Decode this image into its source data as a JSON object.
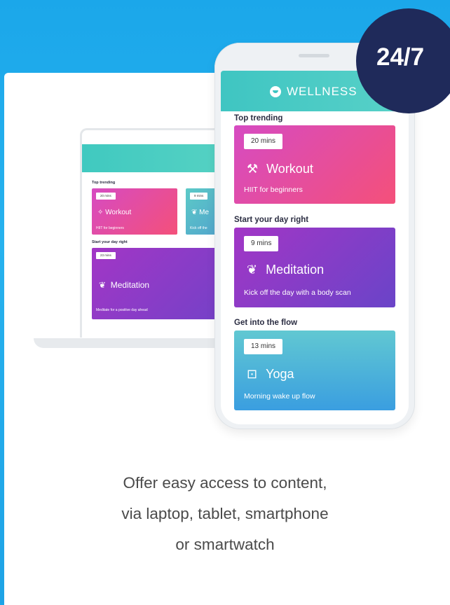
{
  "badge": {
    "text": "24/7"
  },
  "app": {
    "brand": "WELLNESS"
  },
  "phone": {
    "sections": [
      {
        "label": "Top trending",
        "duration": "20 mins",
        "title": "Workout",
        "icon": "dumbbell-icon",
        "subtitle": "HIIT for beginners"
      },
      {
        "label": "Start your day right",
        "duration": "9 mins",
        "title": "Meditation",
        "icon": "lotus-icon",
        "subtitle": "Kick off the day with a body scan"
      },
      {
        "label": "Get into the flow",
        "duration": "13 mins",
        "title": "Yoga",
        "icon": "yoga-mat-icon",
        "subtitle": "Morning wake up flow"
      }
    ]
  },
  "laptop": {
    "top_label": "Top trending",
    "card1": {
      "duration": "20 mins",
      "title": "Workout",
      "subtitle": "HIIT for beginners"
    },
    "card2": {
      "duration": "9 mins",
      "title": "Me",
      "subtitle": "Kick off the"
    },
    "mid_label": "Start your day right",
    "card3": {
      "duration": "23 mins",
      "title": "Meditation",
      "subtitle": "Meditate for a positive day ahead"
    }
  },
  "caption": {
    "line1": "Offer easy access to content,",
    "line2": "via laptop, tablet, smartphone",
    "line3": "or smartwatch"
  },
  "colors": {
    "background": "#1ba7ea",
    "badge": "#1f2a5a",
    "header_teal": "#3fc5c2",
    "workout_pink": "#f4507a",
    "meditation_purple": "#a236c6",
    "yoga_blue": "#3a9ee0"
  }
}
